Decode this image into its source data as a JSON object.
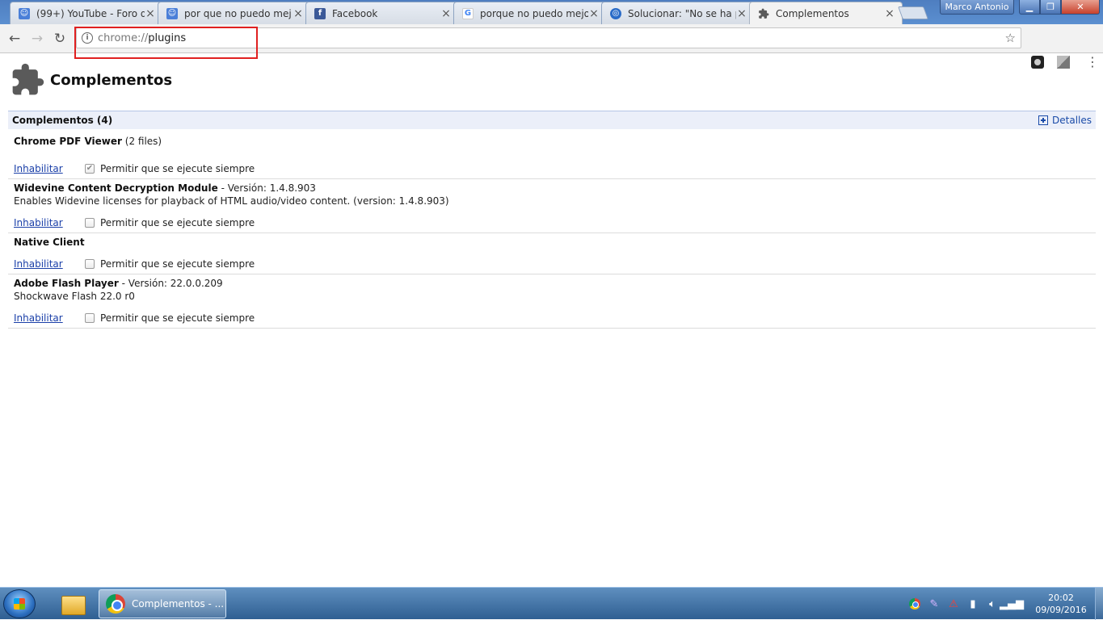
{
  "window": {
    "user_name": "Marco Antonio",
    "minimize_glyph": "▁",
    "maximize_glyph": "❐",
    "close_glyph": "✕"
  },
  "tabs": [
    {
      "title": "(99+) YouTube - Foro d",
      "favicon": "google-product-forums-icon",
      "color": "#4a7fd8",
      "active": false
    },
    {
      "title": "por que no puedo mej",
      "favicon": "google-product-forums-icon",
      "color": "#4a7fd8",
      "active": false
    },
    {
      "title": "Facebook",
      "favicon": "facebook-icon",
      "color": "#3b5998",
      "active": false
    },
    {
      "title": "porque no puedo mejo",
      "favicon": "google-icon",
      "color": "#ffffff",
      "active": false
    },
    {
      "title": "Solucionar: \"No se ha p",
      "favicon": "globe-icon",
      "color": "#2a6cc8",
      "active": false
    },
    {
      "title": "Complementos",
      "favicon": "puzzle-icon",
      "color": "#5a5a5a",
      "active": true
    }
  ],
  "toolbar": {
    "back_glyph": "←",
    "forward_glyph": "→",
    "reload_glyph": "↻",
    "url_scheme": "chrome://",
    "url_path": "plugins",
    "star_glyph": "☆",
    "menu_glyph": "⋮"
  },
  "page": {
    "title": "Complementos",
    "section_title": "Complementos (4)",
    "details_label": "Detalles",
    "plugins": [
      {
        "name": "Chrome PDF Viewer",
        "suffix": "(2 files)",
        "description": "",
        "disable_label": "Inhabilitar",
        "always_allow_label": "Permitir que se ejecute siempre",
        "checked": true
      },
      {
        "name": "Widevine Content Decryption Module",
        "suffix": "- Versión: 1.4.8.903",
        "description": "Enables Widevine licenses for playback of HTML audio/video content. (version: 1.4.8.903)",
        "disable_label": "Inhabilitar",
        "always_allow_label": "Permitir que se ejecute siempre",
        "checked": false
      },
      {
        "name": "Native Client",
        "suffix": "",
        "description": "",
        "disable_label": "Inhabilitar",
        "always_allow_label": "Permitir que se ejecute siempre",
        "checked": false
      },
      {
        "name": "Adobe Flash Player",
        "suffix": "- Versión: 22.0.0.209",
        "description": "Shockwave Flash 22.0 r0",
        "disable_label": "Inhabilitar",
        "always_allow_label": "Permitir que se ejecute siempre",
        "checked": false
      }
    ]
  },
  "taskbar": {
    "chrome_window_label": "Complementos - ...",
    "clock_time": "20:02",
    "clock_date": "09/09/2016",
    "tray_icons": [
      "chrome-icon",
      "feather-icon",
      "warning-icon",
      "power-icon",
      "volume-icon",
      "network-icon"
    ]
  }
}
